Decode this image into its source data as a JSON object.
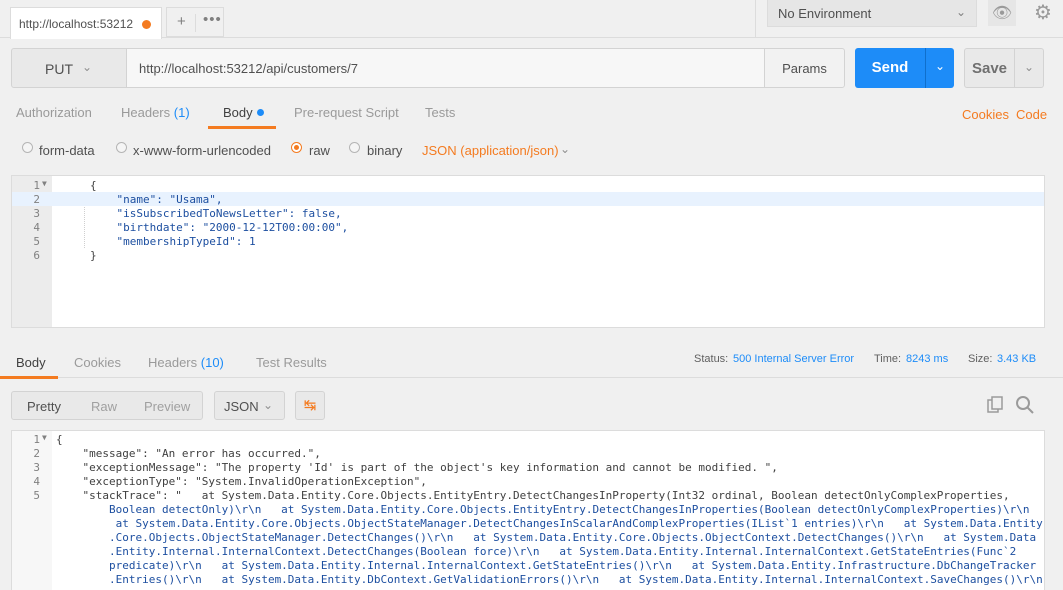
{
  "tab": {
    "title": "http://localhost:53212"
  },
  "env": {
    "selected": "No Environment"
  },
  "request": {
    "method": "PUT",
    "url": "http://localhost:53212/api/customers/7",
    "params_label": "Params",
    "send_label": "Send",
    "save_label": "Save"
  },
  "req_tabs": {
    "authorization": "Authorization",
    "headers": "Headers",
    "headers_count": "(1)",
    "body": "Body",
    "prerequest": "Pre-request Script",
    "tests": "Tests",
    "cookies": "Cookies",
    "code": "Code"
  },
  "body_options": {
    "form_data": "form-data",
    "urlencoded": "x-www-form-urlencoded",
    "raw": "raw",
    "binary": "binary",
    "content_type": "JSON (application/json)"
  },
  "editor_lines": [
    {
      "num": "1",
      "text": "{"
    },
    {
      "num": "2",
      "text": "    \"name\": \"Usama\","
    },
    {
      "num": "3",
      "text": "    \"isSubscribedToNewsLetter\": false,"
    },
    {
      "num": "4",
      "text": "    \"birthdate\": \"2000-12-12T00:00:00\","
    },
    {
      "num": "5",
      "text": "    \"membershipTypeId\": 1"
    },
    {
      "num": "6",
      "text": "}"
    }
  ],
  "res_tabs": {
    "body": "Body",
    "cookies": "Cookies",
    "headers": "Headers",
    "headers_count": "(10)",
    "test_results": "Test Results"
  },
  "status": {
    "status_label": "Status:",
    "status_value": "500 Internal Server Error",
    "time_label": "Time:",
    "time_value": "8243 ms",
    "size_label": "Size:",
    "size_value": "3.43 KB"
  },
  "view": {
    "pretty": "Pretty",
    "raw": "Raw",
    "preview": "Preview",
    "format": "JSON"
  },
  "response_lines": [
    {
      "num": "1",
      "text": "{"
    },
    {
      "num": "2",
      "text": "    \"message\": \"An error has occurred.\","
    },
    {
      "num": "3",
      "text": "    \"exceptionMessage\": \"The property 'Id' is part of the object's key information and cannot be modified. \","
    },
    {
      "num": "4",
      "text": "    \"exceptionType\": \"System.InvalidOperationException\","
    },
    {
      "num": "5",
      "text": "    \"stackTrace\": \"   at System.Data.Entity.Core.Objects.EntityEntry.DetectChangesInProperty(Int32 ordinal, Boolean detectOnlyComplexProperties,"
    }
  ],
  "response_wrap": [
    "Boolean detectOnly)\\r\\n   at System.Data.Entity.Core.Objects.EntityEntry.DetectChangesInProperties(Boolean detectOnlyComplexProperties)\\r\\n",
    " at System.Data.Entity.Core.Objects.ObjectStateManager.DetectChangesInScalarAndComplexProperties(IList`1 entries)\\r\\n   at System.Data.Entity",
    ".Core.Objects.ObjectStateManager.DetectChanges()\\r\\n   at System.Data.Entity.Core.Objects.ObjectContext.DetectChanges()\\r\\n   at System.Data",
    ".Entity.Internal.InternalContext.DetectChanges(Boolean force)\\r\\n   at System.Data.Entity.Internal.InternalContext.GetStateEntries(Func`2",
    "predicate)\\r\\n   at System.Data.Entity.Internal.InternalContext.GetStateEntries()\\r\\n   at System.Data.Entity.Infrastructure.DbChangeTracker",
    ".Entries()\\r\\n   at System.Data.Entity.DbContext.GetValidationErrors()\\r\\n   at System.Data.Entity.Internal.InternalContext.SaveChanges()\\r\\n"
  ]
}
